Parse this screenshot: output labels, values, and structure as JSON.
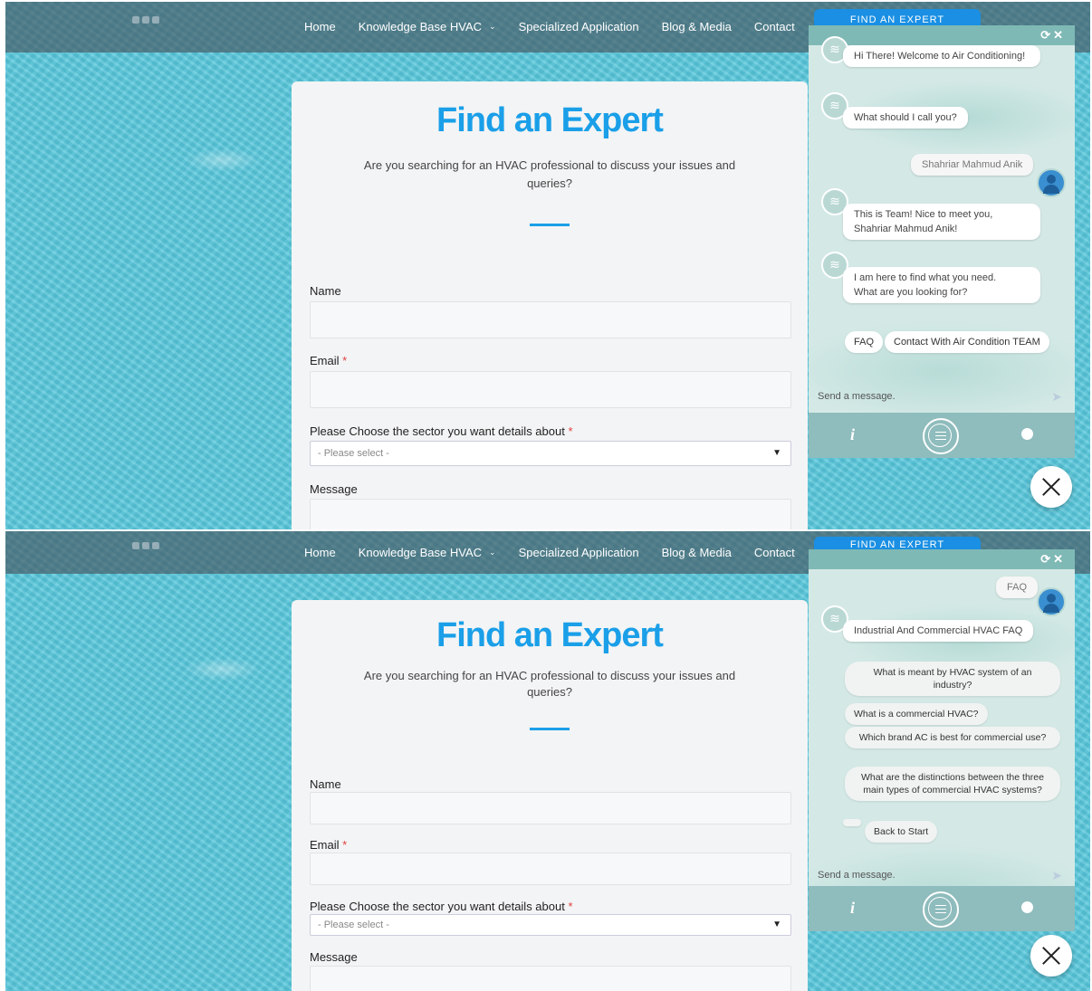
{
  "nav": {
    "items": [
      "Home",
      "Knowledge Base HVAC",
      "Specialized Application",
      "Blog & Media",
      "Contact"
    ],
    "cta_label": "FIND AN EXPERT"
  },
  "page": {
    "title": "Find an Expert",
    "subtitle": "Are you searching for an HVAC professional to discuss your issues and queries?"
  },
  "form": {
    "name_label": "Name",
    "email_label": "Email",
    "sector_label": "Please Choose the sector you want details about",
    "sector_placeholder": "- Please select -",
    "message_label": "Message",
    "required_mark": "*"
  },
  "chat1": {
    "msg_welcome_a": "Hi There! Welcome to ",
    "msg_welcome_b": "Air Conditioning!",
    "msg_ask_name": "What should I call you?",
    "user_name": "Shahriar Mahmud Anik",
    "msg_meet_a": "This is ",
    "msg_meet_b": "Team",
    "msg_meet_c": "! Nice to meet you,",
    "msg_meet_d": "Shahriar Mahmud Anik!",
    "msg_find_1": "I am here to find what you need.",
    "msg_find_2": "What are you looking for?",
    "chip_faq": "FAQ",
    "chip_contact": "Contact With Air Condition TEAM"
  },
  "chat2": {
    "user_msg": "FAQ",
    "bot_msg": "Industrial And Commercial HVAC FAQ",
    "questions": [
      "What is meant by HVAC system of an industry?",
      "What is a commercial HVAC?",
      "Which brand AC is best for commercial use?",
      "What are the distinctions between the three main types of commercial HVAC systems?"
    ],
    "back": "Back to Start"
  },
  "chat_common": {
    "input_placeholder": "Send a message.",
    "info_icon": "i"
  }
}
